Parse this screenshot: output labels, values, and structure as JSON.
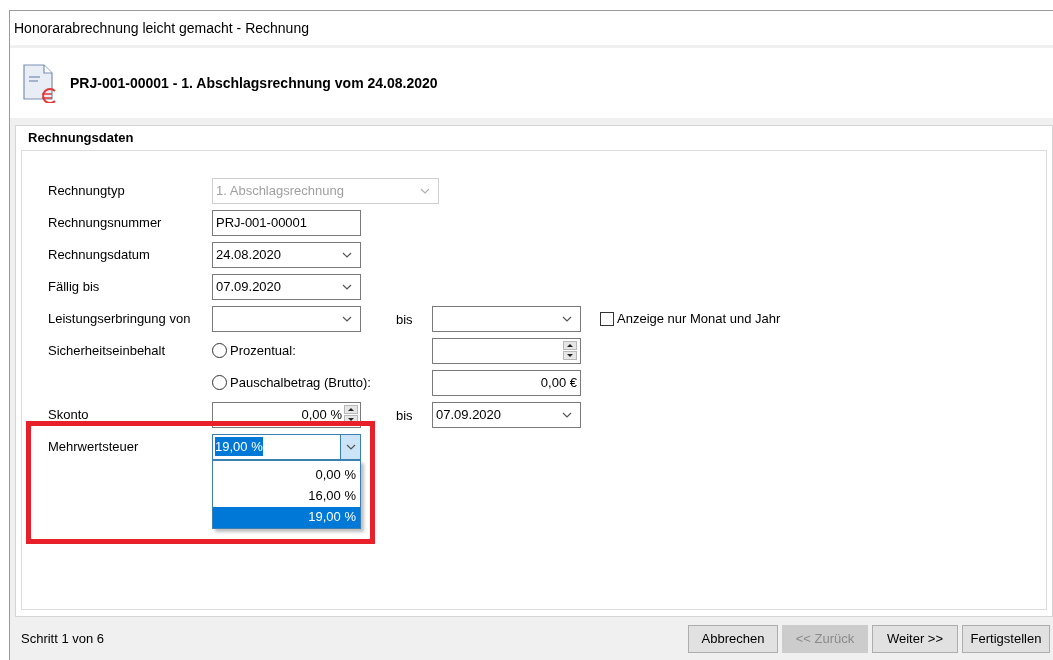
{
  "window": {
    "title": "Honorarabrechnung leicht gemacht - Rechnung"
  },
  "header": {
    "title": "PRJ-001-00001 - 1. Abschlagsrechnung vom 24.08.2020"
  },
  "group": {
    "title": "Rechnungsdaten"
  },
  "rows": [
    {
      "kind": "combo",
      "label": "Rechnungtyp",
      "value": "1. Abschlagsrechnung",
      "disabled": true
    },
    {
      "kind": "text",
      "label": "Rechnungsnummer",
      "value": "PRJ-001-00001"
    },
    {
      "kind": "combo",
      "label": "Rechnungsdatum",
      "value": "24.08.2020",
      "disabled": false
    },
    {
      "kind": "combo",
      "label": "Fällig bis",
      "value": "07.09.2020",
      "disabled": false
    },
    {
      "kind": "range",
      "label": "Leistungserbringung von",
      "to_label": "bis",
      "checkbox": {
        "label": "Anzeige nur Monat und Jahr",
        "checked": false
      }
    },
    {
      "kind": "radio_spin",
      "label": "Sicherheitseinbehalt",
      "option": {
        "label": "Prozentual:",
        "selected": false
      }
    },
    {
      "kind": "radio_amount",
      "option": {
        "label": "Pauschalbetrag (Brutto):",
        "selected": false
      },
      "value": "0,00 €"
    },
    {
      "kind": "skonto",
      "label": "Skonto",
      "value": "0,00 %",
      "to_label": "bis",
      "to_value": "07.09.2020"
    },
    {
      "kind": "vat",
      "label": "Mehrwertsteuer",
      "value": "19,00 %",
      "options": [
        {
          "label": "0,00 %",
          "selected": false
        },
        {
          "label": "16,00 %",
          "selected": false
        },
        {
          "label": "19,00 %",
          "selected": true
        }
      ]
    }
  ],
  "status": "Schritt 1 von 6",
  "buttons": [
    {
      "label": "Abbrechen",
      "disabled": false
    },
    {
      "label": "<< Zurück",
      "disabled": true
    },
    {
      "label": "Weiter >>",
      "disabled": false
    },
    {
      "label": "Fertigstellen",
      "disabled": false
    }
  ]
}
